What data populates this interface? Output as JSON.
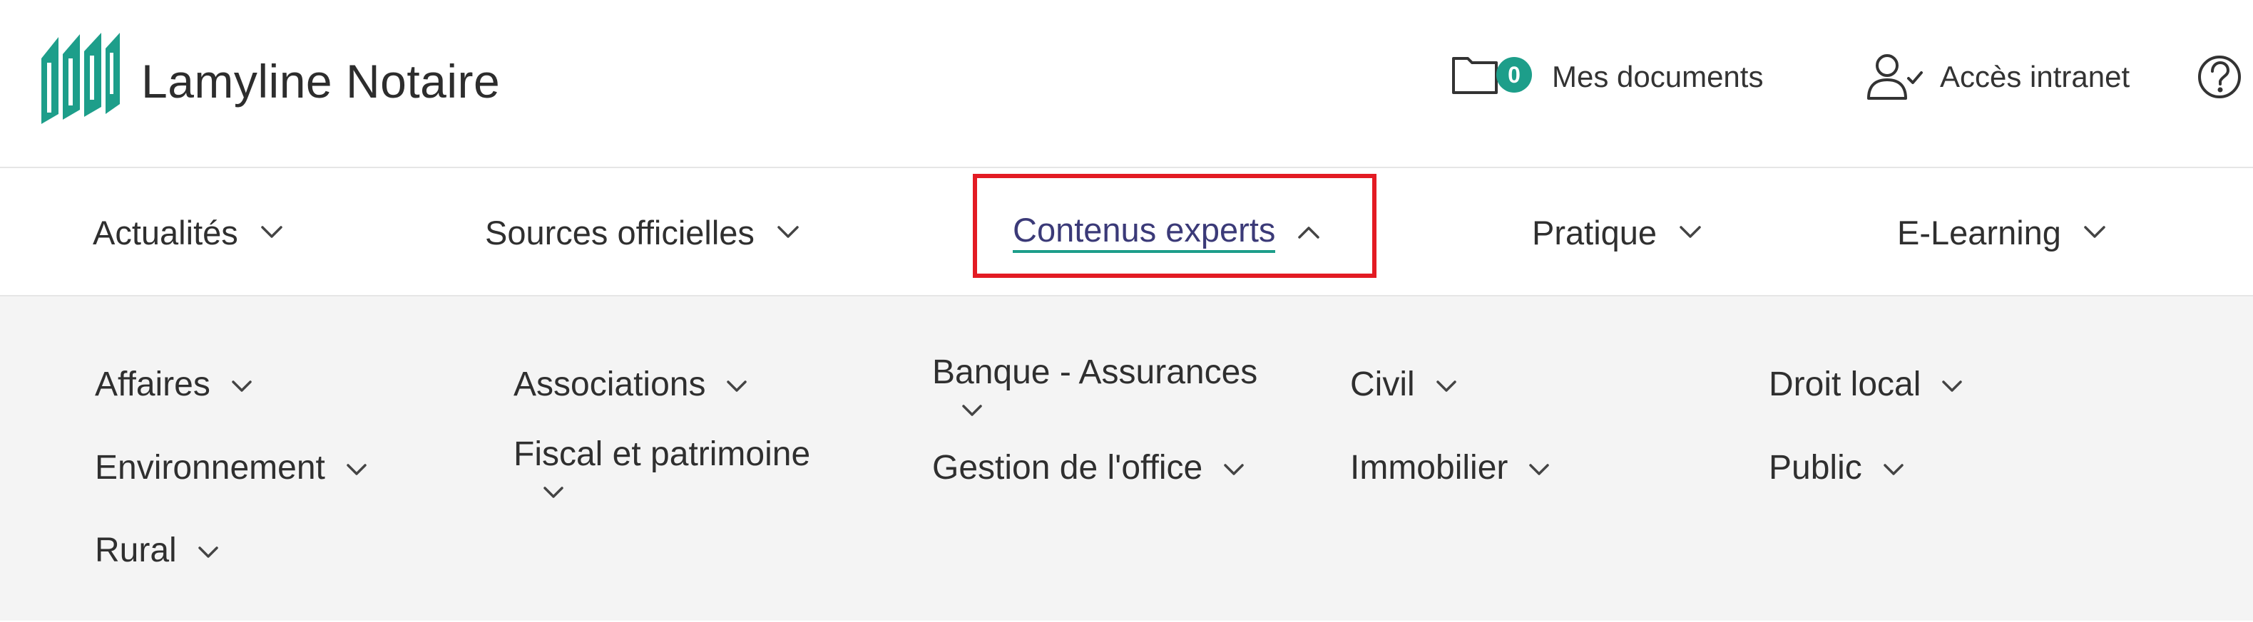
{
  "brand": {
    "name": "Lamyline Notaire",
    "logo_color": "#1d9e8a"
  },
  "header": {
    "documents": {
      "label": "Mes documents",
      "count": "0",
      "icon": "folder-icon"
    },
    "intranet": {
      "label": "Accès intranet",
      "icon": "user-check-icon"
    },
    "help": {
      "icon": "help-icon"
    }
  },
  "nav": {
    "items": [
      {
        "label": "Actualités",
        "expanded": false
      },
      {
        "label": "Sources officielles",
        "expanded": false
      },
      {
        "label": "Contenus experts",
        "expanded": true
      },
      {
        "label": "Pratique",
        "expanded": false
      },
      {
        "label": "E-Learning",
        "expanded": false
      }
    ],
    "active_color": "#3b3a78",
    "underline_color": "#1d9e8a",
    "highlight_color": "#e31b23"
  },
  "mega_menu": {
    "categories": [
      {
        "label": "Affaires"
      },
      {
        "label": "Associations"
      },
      {
        "label": "Banque - Assurances"
      },
      {
        "label": "Civil"
      },
      {
        "label": "Droit local"
      },
      {
        "label": "Environnement"
      },
      {
        "label": "Fiscal et patrimoine"
      },
      {
        "label": "Gestion de l'office"
      },
      {
        "label": "Immobilier"
      },
      {
        "label": "Public"
      },
      {
        "label": "Rural"
      }
    ]
  }
}
